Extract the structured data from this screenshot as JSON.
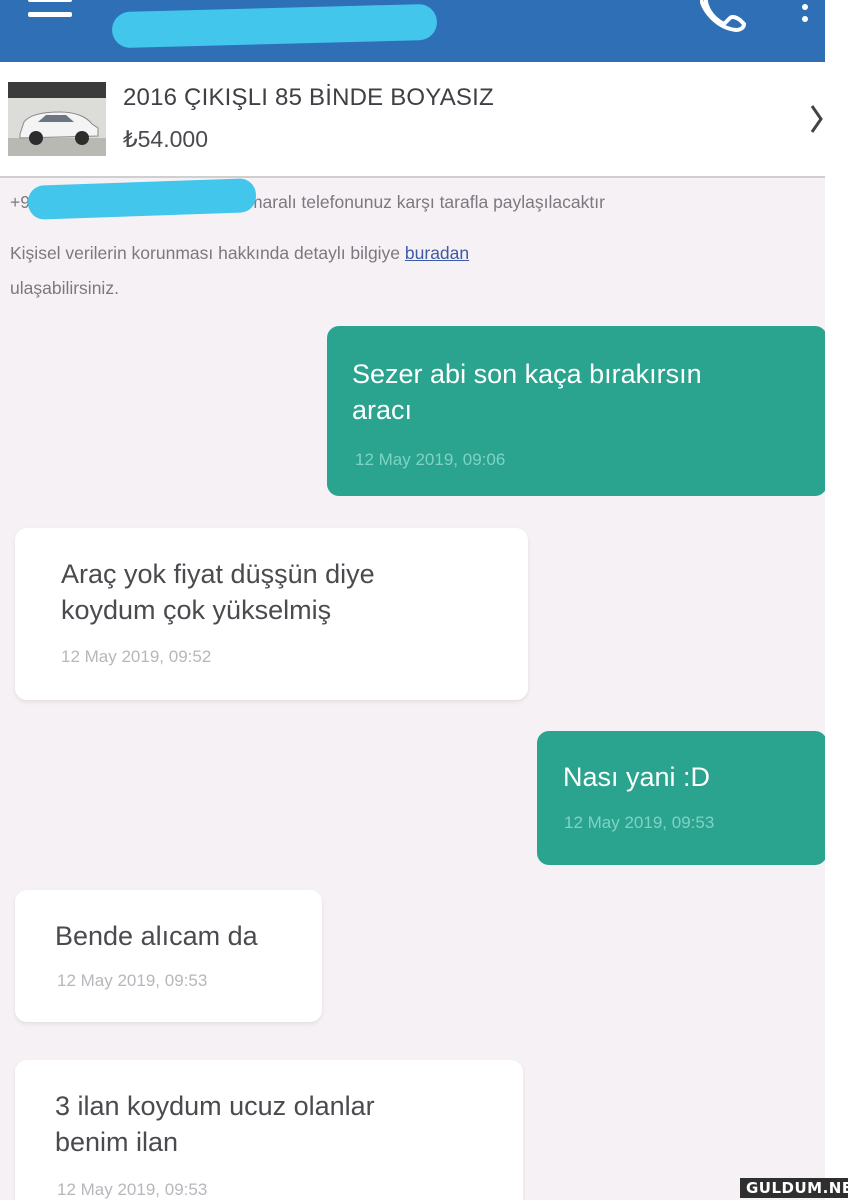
{
  "listing": {
    "title": "2016 ÇIKIŞLI 85 BİNDE BOYASIZ",
    "price": "₺54.000"
  },
  "notice": {
    "line1_prefix": "+9",
    "line1_suffix": "maralı telefonunuz karşı tarafla paylaşılacaktır",
    "line2_text": "Kişisel verilerin korunması hakkında detaylı bilgiye ",
    "line2_link": "buradan",
    "line3": "ulaşabilirsiniz."
  },
  "messages": [
    {
      "direction": "outgoing",
      "lines": [
        "Sezer abi son kaça bırakırsın",
        "aracı"
      ],
      "time": "12 May 2019, 09:06"
    },
    {
      "direction": "incoming",
      "lines": [
        "Araç yok fiyat düşşün diye",
        "koydum çok yükselmiş"
      ],
      "time": "12 May 2019, 09:52"
    },
    {
      "direction": "outgoing",
      "lines": [
        "Nası yani :D"
      ],
      "time": "12 May 2019, 09:53"
    },
    {
      "direction": "incoming",
      "lines": [
        "Bende alıcam da"
      ],
      "time": "12 May 2019, 09:53"
    },
    {
      "direction": "incoming",
      "lines": [
        "3 ilan koydum ucuz olanlar",
        "benim ilan"
      ],
      "time": "12 May 2019, 09:53"
    }
  ],
  "icons": [
    "menu-icon",
    "phone-icon",
    "more-vertical-icon",
    "chevron-right-icon"
  ],
  "colors": {
    "appbar": "#2f6fb6",
    "outgoing_bubble": "#2aa38f",
    "incoming_bubble": "#ffffff",
    "background": "#f6f1f4"
  },
  "watermark": "GULDUM.NET"
}
